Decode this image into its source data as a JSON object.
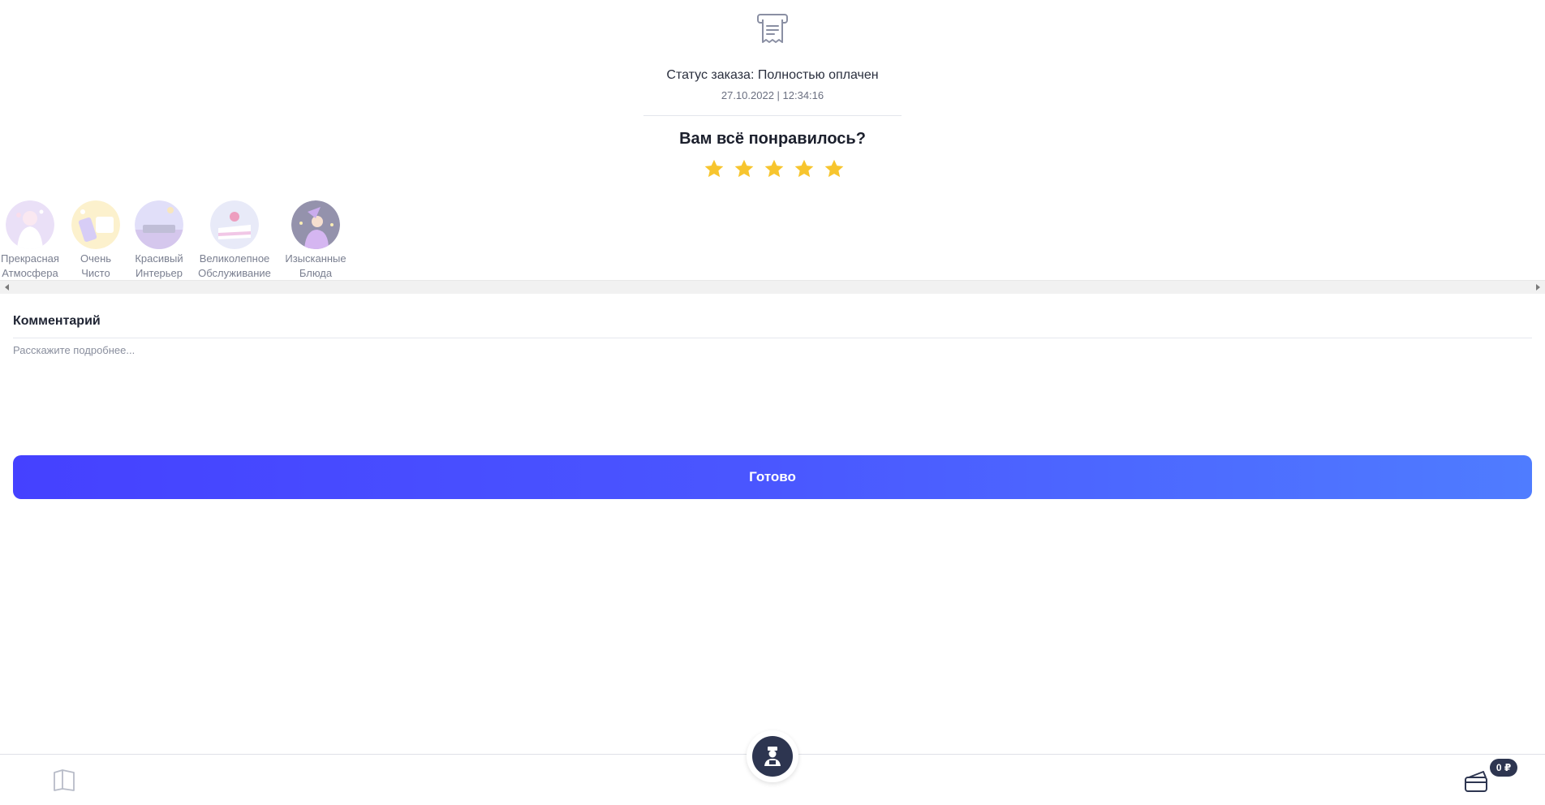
{
  "order": {
    "status_text": "Статус заказа: Полностью оплачен",
    "datetime": "27.10.2022 | 12:34:16"
  },
  "rating": {
    "question": "Вам всё понравилось?",
    "stars_filled": 5,
    "stars_total": 5,
    "star_color": "#f7c52e"
  },
  "tags": [
    {
      "label": "Прекрасная\nАтмосфера",
      "icon": "atmosphere-illustration"
    },
    {
      "label": "Очень\nЧисто",
      "icon": "keep-clean-illustration"
    },
    {
      "label": "Красивый\nИнтерьер",
      "icon": "interior-illustration"
    },
    {
      "label": "Великолепное\nОбслуживание",
      "icon": "cake-illustration"
    },
    {
      "label": "Изысканные\nБлюда",
      "icon": "chef-illustration"
    }
  ],
  "comment": {
    "label": "Комментарий",
    "placeholder": "Расскажите подробнее..."
  },
  "actions": {
    "done_label": "Готово"
  },
  "bottom_bar": {
    "balance": "0 ₽",
    "menu_icon": "book-icon",
    "waiter_icon": "waiter-icon",
    "wallet_icon": "wallet-icon"
  },
  "colors": {
    "accent_start": "#4541ff",
    "accent_end": "#4f7cff",
    "dark": "#2d3550"
  }
}
